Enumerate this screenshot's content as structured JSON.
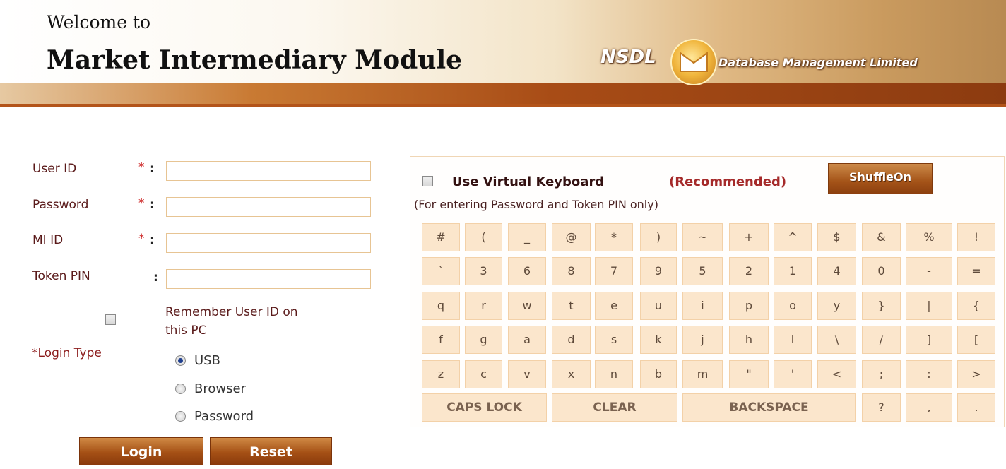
{
  "header": {
    "welcome": "Welcome to",
    "title": "Market Intermediary Module",
    "logo_nsdl": "NSDL",
    "logo_tagline": "Database Management Limited",
    "brand_color": "#a84c16"
  },
  "form": {
    "user_id_label": "User ID",
    "password_label": "Password",
    "mi_id_label": "MI ID",
    "token_pin_label": "Token PIN",
    "required_mark": "*",
    "colon": ":",
    "user_id_value": "",
    "password_value": "",
    "mi_id_value": "",
    "token_pin_value": "",
    "remember_line1": "Remember User ID on",
    "remember_line2": "this PC",
    "login_type_label": "*Login Type",
    "login_types": [
      {
        "label": "USB",
        "selected": true
      },
      {
        "label": "Browser",
        "selected": false
      },
      {
        "label": "Password",
        "selected": false
      }
    ],
    "login_button": "Login",
    "reset_button": "Reset"
  },
  "keyboard": {
    "title": "Use Virtual Keyboard",
    "recommended": "(Recommended)",
    "note": "(For entering Password and Token PIN only)",
    "shuffle_button": "ShuffleOn",
    "rows": [
      [
        "#",
        "(",
        "_",
        "@",
        "*",
        ")",
        "~",
        "+",
        "^",
        "$",
        "&",
        "%",
        "!"
      ],
      [
        "`",
        "3",
        "6",
        "8",
        "7",
        "9",
        "5",
        "2",
        "1",
        "4",
        "0",
        "-",
        "="
      ],
      [
        "q",
        "r",
        "w",
        "t",
        "e",
        "u",
        "i",
        "p",
        "o",
        "y",
        "}",
        "|",
        "{"
      ],
      [
        "f",
        "g",
        "a",
        "d",
        "s",
        "k",
        "j",
        "h",
        "l",
        "\\",
        "/",
        "]",
        "["
      ],
      [
        "z",
        "c",
        "v",
        "x",
        "n",
        "b",
        "m",
        "\"",
        "'",
        "<",
        ";",
        ":",
        ">"
      ]
    ],
    "bottom_row": {
      "caps_lock": "CAPS LOCK",
      "clear": "CLEAR",
      "backspace": "BACKSPACE",
      "question": "?",
      "comma": ",",
      "period": "."
    }
  }
}
